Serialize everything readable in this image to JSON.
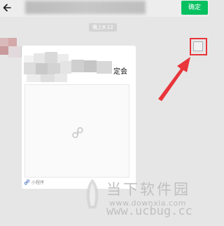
{
  "header": {
    "confirm_label": "确定"
  },
  "chat": {
    "timestamp": "晚上8:12"
  },
  "card": {
    "title_visible_suffix": "定会",
    "footer_label": "小程序"
  },
  "selection": {
    "checked": false
  },
  "watermark": {
    "site_name": "当下软件园",
    "url": "www.downxia.com",
    "domain": "www.ucbug.cc"
  },
  "colors": {
    "confirm_green": "#07c160",
    "highlight_red": "#e8363b"
  },
  "icons": {
    "back": "arrow-left-icon",
    "mini_program": "mini-program-icon",
    "pointer": "red-arrow-icon"
  }
}
